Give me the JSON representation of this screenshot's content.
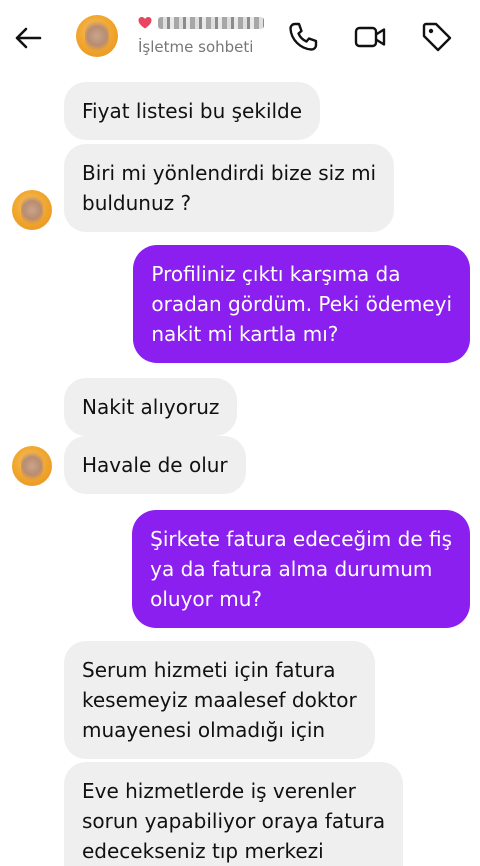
{
  "header": {
    "subtitle": "İşletme sohbeti",
    "name_redacted": true
  },
  "icons": {
    "back": "arrow-left-icon",
    "call": "phone-icon",
    "video": "video-camera-icon",
    "tag": "tag-icon"
  },
  "colors": {
    "outgoing_bubble": "#8a1ff0",
    "incoming_bubble": "#efefef"
  },
  "messages": [
    {
      "direction": "in",
      "lines": [
        "Fiyat listesi bu şekilde"
      ]
    },
    {
      "direction": "in",
      "lines": [
        "Biri mi yönlendirdi bize siz mi",
        "buldunuz ?"
      ]
    },
    {
      "direction": "out",
      "lines": [
        "Profiliniz çıktı karşıma da",
        "oradan gördüm. Peki ödemeyi",
        "nakit mi kartla mı?"
      ]
    },
    {
      "direction": "in",
      "lines": [
        "Nakit alıyoruz"
      ]
    },
    {
      "direction": "in",
      "lines": [
        "Havale de olur"
      ]
    },
    {
      "direction": "out",
      "lines": [
        "Şirkete fatura edeceğim de fiş",
        "ya da fatura alma durumum",
        "oluyor mu?"
      ]
    },
    {
      "direction": "in",
      "lines": [
        "Serum hizmeti için fatura",
        "kesemeyiz maalesef doktor",
        "muayenesi olmadığı için"
      ]
    },
    {
      "direction": "in",
      "lines": [
        "Eve hizmetlerde iş verenler",
        "sorun yapabiliyor oraya fatura",
        "edecekseniz tıp merkezi"
      ]
    }
  ]
}
